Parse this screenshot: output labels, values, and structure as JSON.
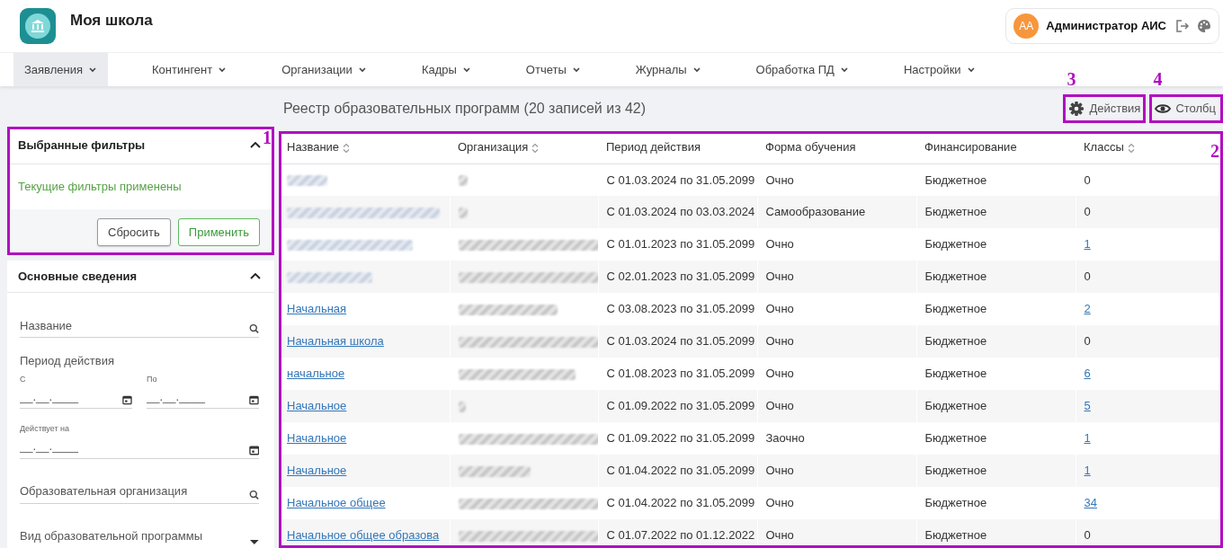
{
  "app": {
    "title": "Моя школа",
    "user": {
      "initials": "АА",
      "name": "Администратор АИС"
    }
  },
  "nav": [
    {
      "label": "Заявления",
      "selected": true
    },
    {
      "label": "Контингент",
      "selected": false
    },
    {
      "label": "Организации",
      "selected": false
    },
    {
      "label": "Кадры",
      "selected": false
    },
    {
      "label": "Отчеты",
      "selected": false
    },
    {
      "label": "Журналы",
      "selected": false
    },
    {
      "label": "Обработка ПД",
      "selected": false
    },
    {
      "label": "Настройки",
      "selected": false
    }
  ],
  "filters_panel": {
    "title": "Выбранные фильтры",
    "expanded": true,
    "status": "Текущие фильтры применены",
    "annotation": "1",
    "buttons": [
      {
        "label": "Сбросить",
        "kind": "secondary"
      },
      {
        "label": "Применить",
        "kind": "success"
      }
    ]
  },
  "basic_panel": {
    "title": "Основные сведения",
    "expanded": true,
    "fields": [
      {
        "kind": "search",
        "placeholder": "Название"
      },
      {
        "kind": "date-range",
        "label": "Период действия",
        "from_label": "С",
        "to_label": "По",
        "from_placeholder": "__.__.____",
        "to_placeholder": "__.__.____"
      },
      {
        "kind": "date",
        "label": "Действует на",
        "placeholder": "__.__.____"
      },
      {
        "kind": "search",
        "placeholder": "Образовательная организация"
      },
      {
        "kind": "select",
        "placeholder": "Вид образовательной программы"
      }
    ]
  },
  "registry": {
    "title": "Реестр образовательных программ (20 записей из 42)",
    "actions": [
      {
        "label": "Действия",
        "annotation": "3"
      },
      {
        "label": "Столбц",
        "annotation": "4"
      }
    ],
    "table": {
      "annotation": "2",
      "columns": [
        {
          "label": "Название",
          "sortable": true
        },
        {
          "label": "Организация",
          "sortable": true
        },
        {
          "label": "Период действия",
          "sortable": false
        },
        {
          "label": "Форма обучения",
          "sortable": false
        },
        {
          "label": "Финансирование",
          "sortable": false
        },
        {
          "label": "Классы",
          "sortable": true
        }
      ],
      "rows": [
        {
          "name_redacted": true,
          "organization_redacted": true,
          "period": "С 01.03.2024 по 31.05.2099",
          "form": "Очно",
          "funding": "Бюджетное",
          "classes": "0",
          "classes_link": false
        },
        {
          "name_redacted": true,
          "organization_redacted": true,
          "period": "С 01.03.2024 по 03.03.2024",
          "form": "Самообразование",
          "funding": "Бюджетное",
          "classes": "0",
          "classes_link": false
        },
        {
          "name_redacted": true,
          "organization_redacted": true,
          "period": "С 01.01.2023 по 31.05.2099",
          "form": "Очно",
          "funding": "Бюджетное",
          "classes": "1",
          "classes_link": true
        },
        {
          "name_redacted": true,
          "organization_redacted": true,
          "period": "С 02.01.2023 по 31.05.2099",
          "form": "Очно",
          "funding": "Бюджетное",
          "classes": "0",
          "classes_link": false
        },
        {
          "name": "Начальная",
          "name_redacted": false,
          "organization_redacted": true,
          "period": "С 03.08.2023 по 31.05.2099",
          "form": "Очно",
          "funding": "Бюджетное",
          "classes": "2",
          "classes_link": true
        },
        {
          "name": "Начальная школа",
          "name_redacted": false,
          "organization_redacted": true,
          "period": "С 01.03.2024 по 31.05.2099",
          "form": "Очно",
          "funding": "Бюджетное",
          "classes": "0",
          "classes_link": false
        },
        {
          "name": "начальное",
          "name_redacted": false,
          "organization_redacted": true,
          "period": "С 01.08.2023 по 31.05.2099",
          "form": "Очно",
          "funding": "Бюджетное",
          "classes": "6",
          "classes_link": true
        },
        {
          "name": "Начальное",
          "name_redacted": false,
          "organization_redacted": true,
          "period": "С 01.09.2022 по 31.05.2099",
          "form": "Очно",
          "funding": "Бюджетное",
          "classes": "5",
          "classes_link": true
        },
        {
          "name": "Начальное",
          "name_redacted": false,
          "organization_redacted": true,
          "period": "С 01.09.2022 по 31.05.2099",
          "form": "Заочно",
          "funding": "Бюджетное",
          "classes": "1",
          "classes_link": true
        },
        {
          "name": "Начальное",
          "name_redacted": false,
          "organization_redacted": true,
          "period": "С 01.04.2022 по 31.05.2099",
          "form": "Очно",
          "funding": "Бюджетное",
          "classes": "1",
          "classes_link": true
        },
        {
          "name": "Начальное общее",
          "name_redacted": false,
          "organization_redacted": true,
          "period": "С 01.04.2022 по 31.05.2099",
          "form": "Очно",
          "funding": "Бюджетное",
          "classes": "34",
          "classes_link": true
        },
        {
          "name": "Начальное общее образова",
          "name_redacted": false,
          "organization_redacted": true,
          "period": "С 01.07.2022 по 01.12.2022",
          "form": "Очно",
          "funding": "Бюджетное",
          "classes": "0",
          "classes_link": false
        }
      ]
    }
  }
}
